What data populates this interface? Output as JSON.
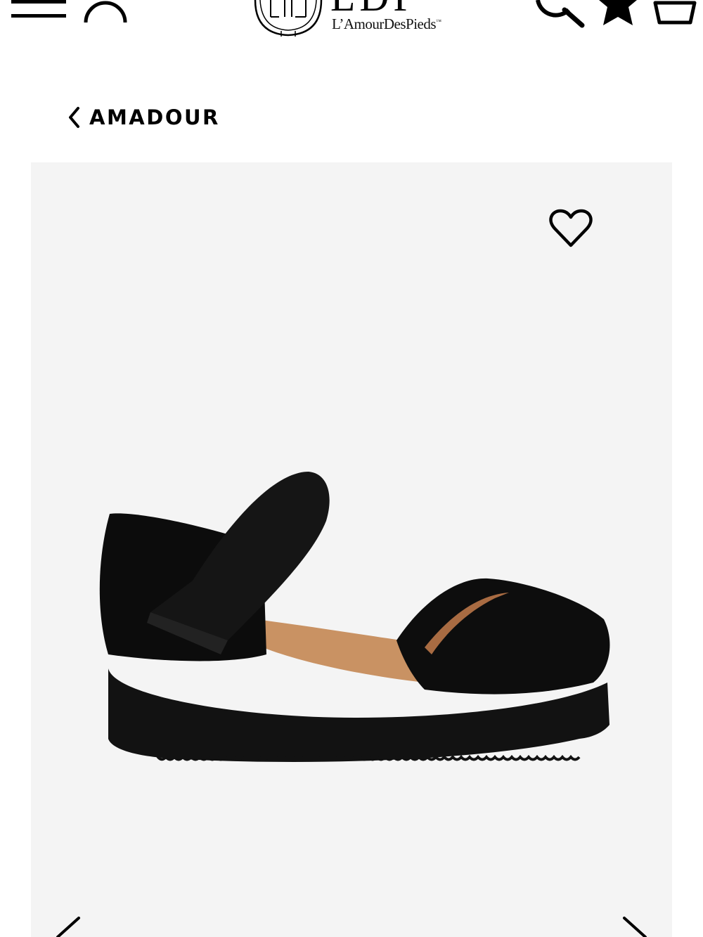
{
  "header": {
    "menu_icon": "hamburger-menu-icon",
    "account_icon": "user-account-icon",
    "logo": {
      "letters": "LDP",
      "tagline": "L’AmourDesPieds",
      "trademark": "™"
    },
    "search_icon": "search-icon",
    "favorites_icon": "star-icon",
    "cart_icon": "shopping-bag-icon"
  },
  "product": {
    "title": "AMADOUR",
    "back_icon": "chevron-left-icon",
    "wishlist_icon": "heart-icon",
    "image_alt": "black suede platform sandal"
  },
  "gallery": {
    "prev_icon": "chevron-left-icon",
    "next_icon": "chevron-right-icon",
    "background_color": "#f4f4f4"
  }
}
